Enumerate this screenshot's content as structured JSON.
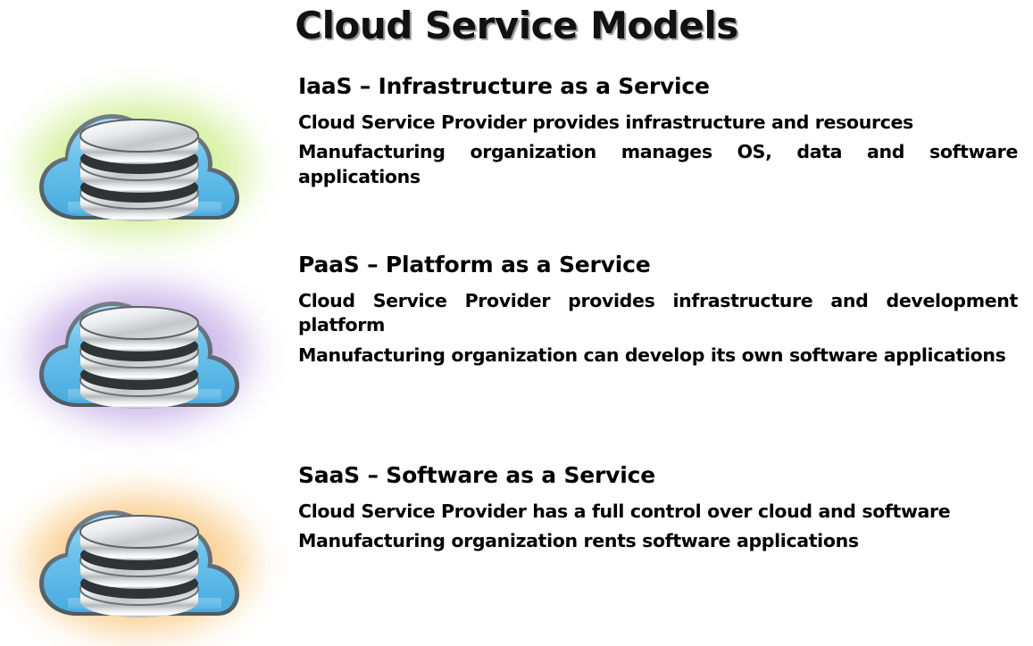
{
  "title": "Cloud Service Models",
  "sections": [
    {
      "id": "iaas",
      "heading": "IaaS – Infrastructure as a Service",
      "glow_color": "#c4ec7a",
      "glow_name": "green",
      "icon": "cloud-database-icon",
      "lines": [
        "Cloud Service Provider provides infrastructure and resources",
        "Manufacturing organization manages OS, data and software applications"
      ]
    },
    {
      "id": "paas",
      "heading": "PaaS – Platform as a Service",
      "glow_color": "#bda4e0",
      "glow_name": "purple",
      "icon": "cloud-database-icon",
      "lines": [
        "Cloud Service Provider provides infrastructure and development platform",
        "Manufacturing organization can develop its own software applications"
      ]
    },
    {
      "id": "saas",
      "heading": "SaaS – Software as a Service",
      "glow_color": "#f8bf6a",
      "glow_name": "orange",
      "icon": "cloud-database-icon",
      "lines": [
        "Cloud Service Provider has a full control over cloud and software",
        "Manufacturing organization rents software applications"
      ]
    }
  ],
  "palette": {
    "cloud_blue_light": "#8fd3f2",
    "cloud_blue": "#55b5e6",
    "cloud_outline": "#5a6670",
    "chrome_light": "#ffffff",
    "chrome_mid": "#c9ccce",
    "chrome_dark": "#8d9295",
    "disc_gap": "#2b3033",
    "background": "#ffffff",
    "text": "#000000"
  }
}
